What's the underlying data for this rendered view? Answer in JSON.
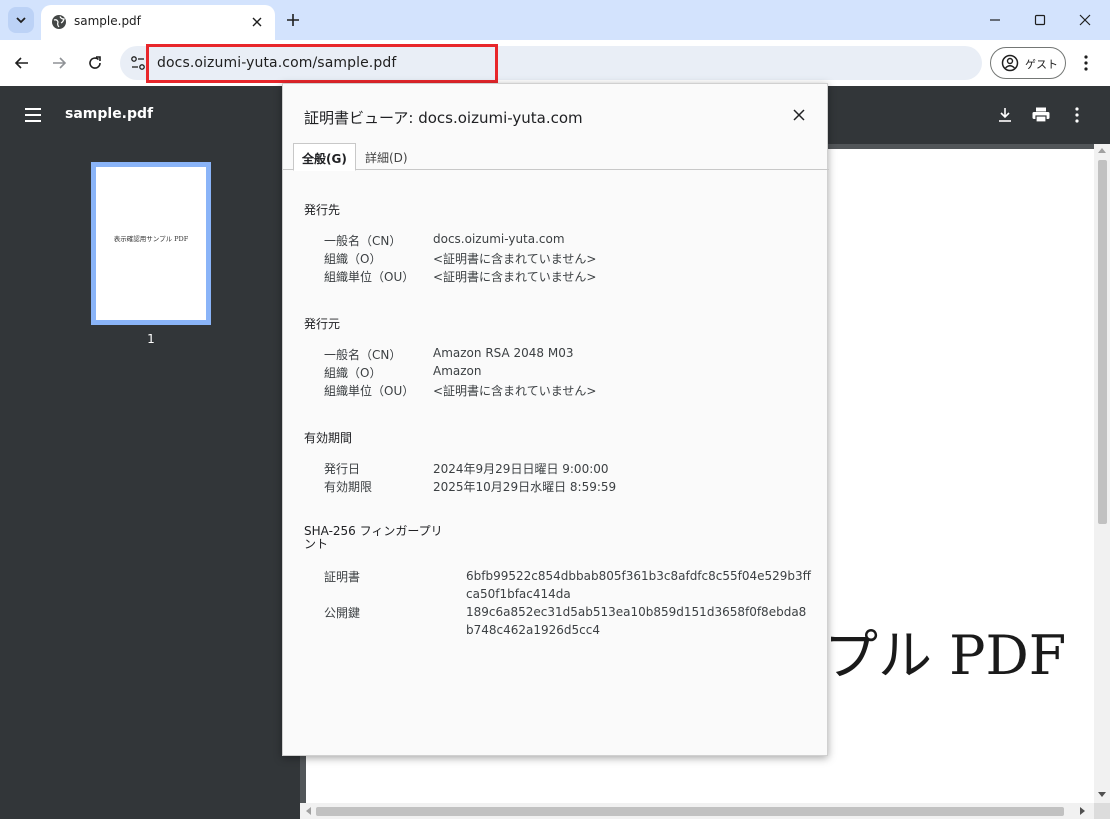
{
  "browser": {
    "tab_title": "sample.pdf",
    "url": "docs.oizumi-yuta.com/sample.pdf",
    "profile_label": "ゲスト",
    "icons": [
      "tab-search-icon",
      "globe-icon",
      "close-icon",
      "plus-icon",
      "minimize-icon",
      "maximize-icon",
      "back-arrow-icon",
      "forward-arrow-icon",
      "reload-icon",
      "site-info-icon",
      "person-icon",
      "kebab-menu-icon"
    ],
    "highlight_color": "#e8262b"
  },
  "pdf": {
    "title": "sample.pdf",
    "thumbnail_text": "表示確認用サンプル PDF",
    "thumbnail_page": "1",
    "page_visible_text": "プル PDF"
  },
  "cert": {
    "title": "証明書ビューア: docs.oizumi-yuta.com",
    "tabs": [
      "全般(G)",
      "詳細(D)"
    ],
    "issued_to": {
      "heading": "発行先",
      "rows": [
        {
          "label": "一般名（CN）",
          "value": "docs.oizumi-yuta.com"
        },
        {
          "label": "組織（O）",
          "value": "<証明書に含まれていません>"
        },
        {
          "label": "組織単位（OU）",
          "value": "<証明書に含まれていません>"
        }
      ]
    },
    "issued_by": {
      "heading": "発行元",
      "rows": [
        {
          "label": "一般名（CN）",
          "value": "Amazon RSA 2048 M03"
        },
        {
          "label": "組織（O）",
          "value": "Amazon"
        },
        {
          "label": "組織単位（OU）",
          "value": "<証明書に含まれていません>"
        }
      ]
    },
    "validity": {
      "heading": "有効期間",
      "rows": [
        {
          "label": "発行日",
          "value": "2024年9月29日日曜日 9:00:00"
        },
        {
          "label": "有効期限",
          "value": "2025年10月29日水曜日 8:59:59"
        }
      ]
    },
    "fingerprints": {
      "heading_line1": "SHA-256 フィンガープリ",
      "heading_line2": "ント",
      "rows": [
        {
          "label": "証明書",
          "value": "6bfb99522c854dbbab805f361b3c8afdfc8c55f04e529b3ffca50f1bfac414da"
        },
        {
          "label": "公開鍵",
          "value": "189c6a852ec31d5ab513ea10b859d151d3658f0f8ebda8b748c462a1926d5cc4"
        }
      ]
    }
  }
}
